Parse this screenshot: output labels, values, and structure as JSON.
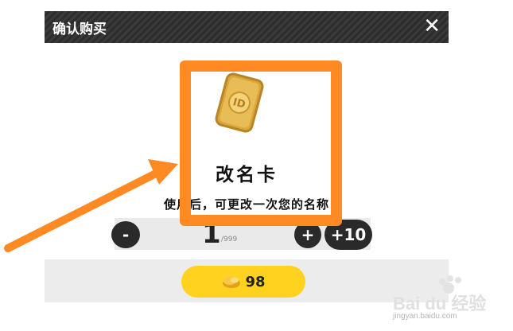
{
  "dialog": {
    "title": "确认购买",
    "close_label": "✕",
    "item": {
      "name": "改名卡",
      "description": "使用后，可更改一次您的名称"
    },
    "quantity": {
      "decrement_label": "-",
      "value": "1",
      "max": "/999",
      "increment_label": "+",
      "increment_ten_label": "+10"
    },
    "price": {
      "value": "98"
    }
  },
  "watermark": {
    "brand": "Bai du 经验",
    "url": "jingyan.baidu.com"
  },
  "colors": {
    "highlight": "#ff8a24",
    "price_button": "#ffd21f",
    "titlebar": "#2c2c2c"
  }
}
